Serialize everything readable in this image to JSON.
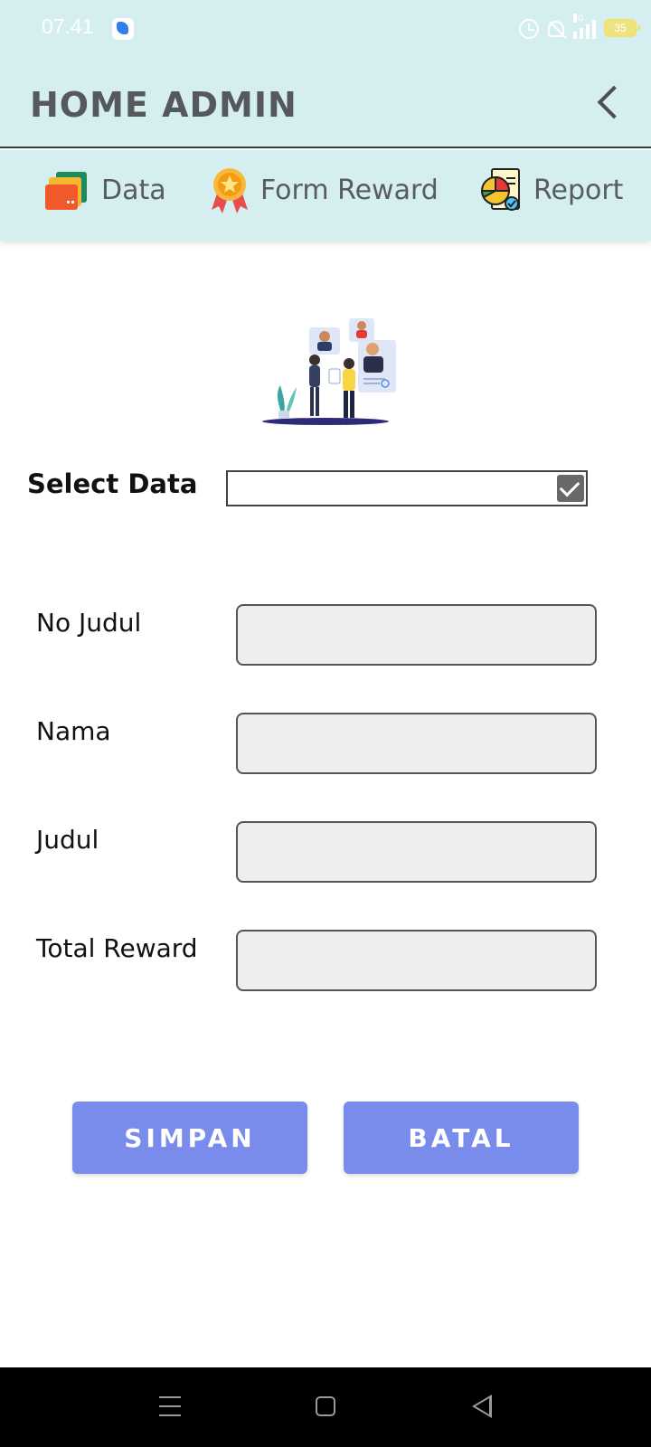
{
  "status_bar": {
    "time": "07.41",
    "network": "4G",
    "battery": "35"
  },
  "app_bar": {
    "title": "HOME ADMIN"
  },
  "nav": {
    "items": [
      {
        "label": "Data",
        "icon": "folder-icon"
      },
      {
        "label": "Form Reward",
        "icon": "award-medal-icon"
      },
      {
        "label": "Report",
        "icon": "report-chart-icon"
      }
    ]
  },
  "form": {
    "select_label": "Select Data",
    "fields": [
      {
        "label": "No Judul",
        "value": ""
      },
      {
        "label": "Nama",
        "value": ""
      },
      {
        "label": "Judul",
        "value": ""
      },
      {
        "label": "Total Reward",
        "value": ""
      }
    ]
  },
  "buttons": {
    "save": "SIMPAN",
    "cancel": "BATAL"
  },
  "colors": {
    "header_bg": "#d5eff1",
    "button_bg": "#7a8ceb",
    "input_bg": "#eeeeee"
  }
}
